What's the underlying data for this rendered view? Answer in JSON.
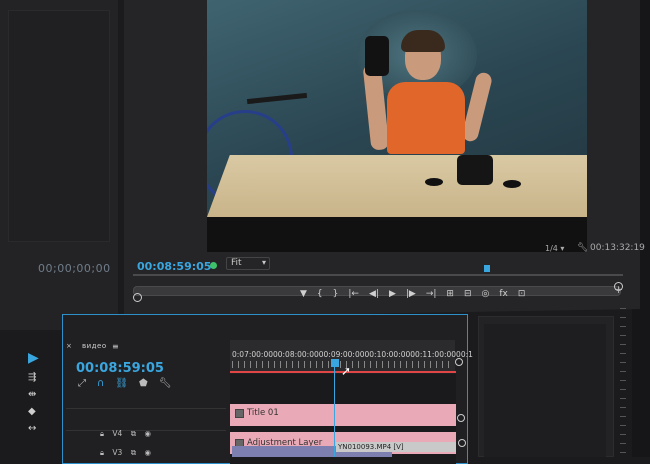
{
  "source_panel": {
    "timecode": "00;00;00;00",
    "add_label": "+"
  },
  "program_monitor": {
    "timecode": "00:08:59:05",
    "zoom_select": "Fit",
    "resolution_select": "1/4",
    "duration": "00:13:32:19",
    "transport_buttons": [
      "marker",
      "in",
      "out",
      "go-to-in",
      "step-back",
      "play",
      "step-forward",
      "go-to-out",
      "insert",
      "overwrite",
      "export-frame",
      "comparison",
      "button-editor"
    ],
    "transport_glyphs": [
      "▼",
      "{",
      "}",
      "|←",
      "◀|",
      "▶",
      "|▶",
      "→|",
      "⊞",
      "⊟",
      "◎",
      "fx",
      "⊡"
    ],
    "add_label": "+"
  },
  "timeline": {
    "sequence_name": "видео",
    "timecode": "00:08:59:05",
    "ruler_labels": [
      "0:07:00:00",
      "00:08:00:00",
      "00:09:00:00",
      "00:10:00:00",
      "00:11:00:00",
      "00:1"
    ],
    "tracks": [
      {
        "name": "V4",
        "clip": "Title 01"
      },
      {
        "name": "V3",
        "clip": "Adjustment Layer"
      }
    ],
    "v1_clip_label": "YN010093.MP4 [V]"
  },
  "colors": {
    "accent_blue": "#3aa6e0",
    "clip_pink": "#e9a9b6",
    "playhead": "#3aa6e0",
    "work_area_red": "#e04646",
    "status_green": "#3ec36b"
  }
}
